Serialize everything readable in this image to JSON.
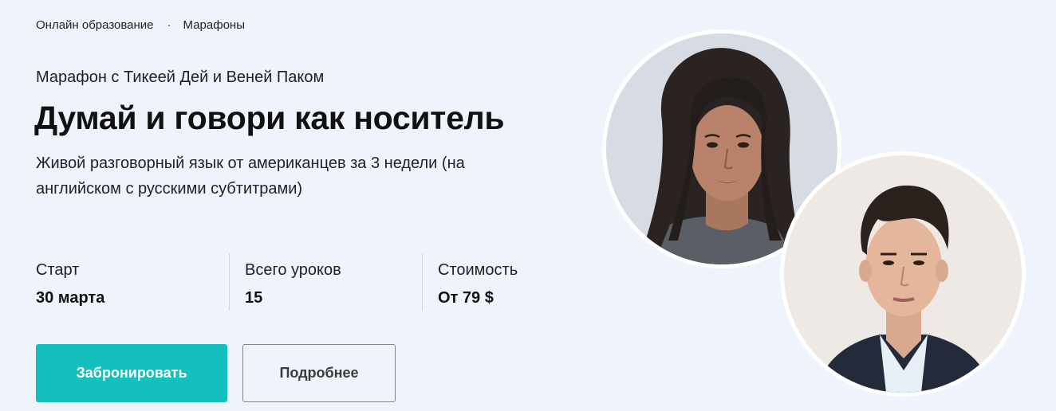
{
  "breadcrumb": {
    "items": [
      "Онлайн образование",
      "Марафоны"
    ],
    "separator": "·"
  },
  "hero": {
    "eyebrow": "Марафон с Тикеей Дей и Веней Паком",
    "title": "Думай и говори как носитель",
    "subtitle": "Живой разговорный язык от американцев за 3 недели (на английском с русскими субтитрами)"
  },
  "stats": [
    {
      "label": "Старт",
      "value": "30 марта"
    },
    {
      "label": "Всего уроков",
      "value": "15"
    },
    {
      "label": "Стоимость",
      "value": "От 79 $"
    }
  ],
  "actions": {
    "primary_label": "Забронировать",
    "secondary_label": "Подробнее"
  },
  "colors": {
    "background": "#eff4fc",
    "primary_button": "#14c0bf",
    "text": "#111111"
  }
}
